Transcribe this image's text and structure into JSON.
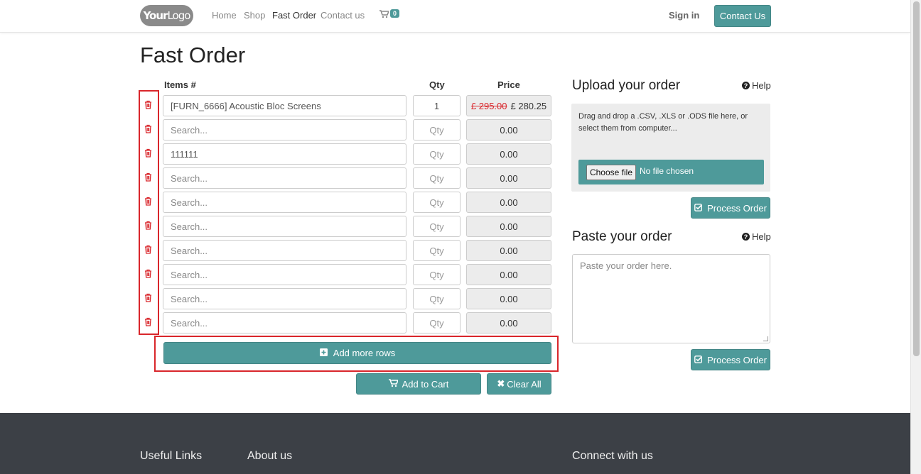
{
  "navbar": {
    "logo_bold": "Your",
    "logo_thin": "Logo",
    "links": [
      {
        "label": "Home",
        "active": false
      },
      {
        "label": "Shop",
        "active": false
      },
      {
        "label": "Fast Order",
        "active": true
      },
      {
        "label": "Contact us",
        "active": false
      }
    ],
    "cart_count": "0",
    "signin_label": "Sign in",
    "contact_button": "Contact Us"
  },
  "page": {
    "title": "Fast Order"
  },
  "order_table": {
    "headers": {
      "items": "Items #",
      "qty": "Qty",
      "price": "Price"
    },
    "rows": [
      {
        "item": "[FURN_6666] Acoustic Bloc Screens",
        "item_is_value": true,
        "qty": "1",
        "qty_is_value": true,
        "old_price": "£ 295.00",
        "price": "£ 280.25"
      },
      {
        "item": "Search...",
        "item_is_value": false,
        "qty": "Qty",
        "qty_is_value": false,
        "old_price": "",
        "price": "0.00"
      },
      {
        "item": "111111",
        "item_is_value": true,
        "qty": "Qty",
        "qty_is_value": false,
        "old_price": "",
        "price": "0.00"
      },
      {
        "item": "Search...",
        "item_is_value": false,
        "qty": "Qty",
        "qty_is_value": false,
        "old_price": "",
        "price": "0.00"
      },
      {
        "item": "Search...",
        "item_is_value": false,
        "qty": "Qty",
        "qty_is_value": false,
        "old_price": "",
        "price": "0.00"
      },
      {
        "item": "Search...",
        "item_is_value": false,
        "qty": "Qty",
        "qty_is_value": false,
        "old_price": "",
        "price": "0.00"
      },
      {
        "item": "Search...",
        "item_is_value": false,
        "qty": "Qty",
        "qty_is_value": false,
        "old_price": "",
        "price": "0.00"
      },
      {
        "item": "Search...",
        "item_is_value": false,
        "qty": "Qty",
        "qty_is_value": false,
        "old_price": "",
        "price": "0.00"
      },
      {
        "item": "Search...",
        "item_is_value": false,
        "qty": "Qty",
        "qty_is_value": false,
        "old_price": "",
        "price": "0.00"
      },
      {
        "item": "Search...",
        "item_is_value": false,
        "qty": "Qty",
        "qty_is_value": false,
        "old_price": "",
        "price": "0.00"
      }
    ],
    "add_rows_label": "Add more rows",
    "add_to_cart_label": "Add to Cart",
    "clear_all_label": "Clear All"
  },
  "upload": {
    "title": "Upload your order",
    "help_label": "Help",
    "instructions": "Drag and drop a .CSV, .XLS or .ODS file here, or select them from computer...",
    "choose_file_label": "Choose file",
    "no_file_label": "No file chosen",
    "process_label": "Process Order"
  },
  "paste": {
    "title": "Paste your order",
    "help_label": "Help",
    "placeholder": "Paste your order here.",
    "process_label": "Process Order"
  },
  "footer": {
    "useful_links": "Useful Links",
    "about_us": "About us",
    "connect": "Connect with us"
  },
  "colors": {
    "teal": "#4e9a9a",
    "danger": "#d9262b",
    "footer": "#3c4046"
  }
}
